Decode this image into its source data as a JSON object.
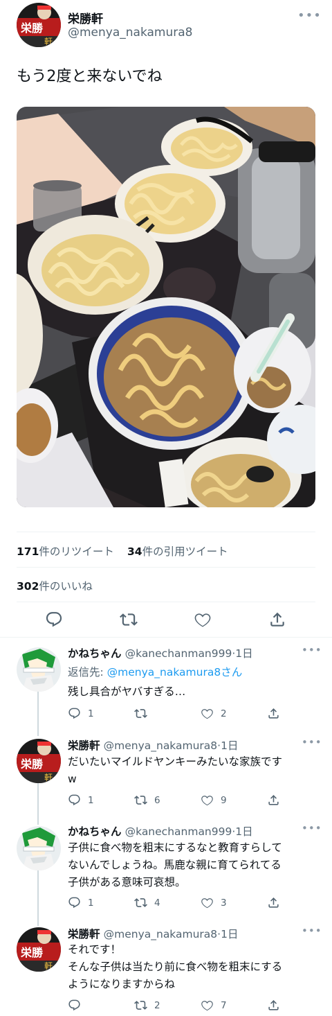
{
  "tweet": {
    "author_name": "栄勝軒",
    "author_handle": "@menya_nakamura8",
    "text": "もう2度と来ないでね",
    "more_icon": "more-dots-icon",
    "retweets_count": "171",
    "retweets_label": "件のリツイート",
    "quotes_count": "34",
    "quotes_label": "件の引用ツイート",
    "likes_count": "302",
    "likes_label": "件のいいね",
    "actions": [
      "reply-icon",
      "retweet-icon",
      "like-icon",
      "share-icon"
    ]
  },
  "replies": [
    {
      "name": "かねちゃん",
      "handle": "@kanechanman999",
      "time": "·1日",
      "reply_to_prefix": "返信先: ",
      "reply_to_mention": "@menya_nakamura8さん",
      "text": "残し具合がヤバすぎる…",
      "reply_count": "1",
      "retweet_count": "",
      "like_count": "2"
    },
    {
      "name": "栄勝軒",
      "handle": "@menya_nakamura8",
      "time": "·1日",
      "text_lines": [
        "だいたいマイルドヤンキーみたいな家族です",
        "w"
      ],
      "reply_count": "1",
      "retweet_count": "6",
      "like_count": "9"
    },
    {
      "name": "かねちゃん",
      "handle": "@kanechanman999",
      "time": "·1日",
      "text_lines": [
        "子供に食べ物を粗末にするなと教育すらして",
        "ないんでしょうね。馬鹿な親に育てられてる",
        "子供がある意味可哀想。"
      ],
      "reply_count": "1",
      "retweet_count": "4",
      "like_count": "3"
    },
    {
      "name": "栄勝軒",
      "handle": "@menya_nakamura8",
      "time": "·1日",
      "text_lines": [
        "それです！",
        "そんな子供は当たり前に食べ物を粗末にする",
        "ようになりますからね"
      ],
      "reply_count": "",
      "retweet_count": "2",
      "like_count": "7"
    }
  ],
  "colors": {
    "accent": "#1d9bf0",
    "secondary_text": "#536471",
    "divider": "#eff3f4"
  }
}
